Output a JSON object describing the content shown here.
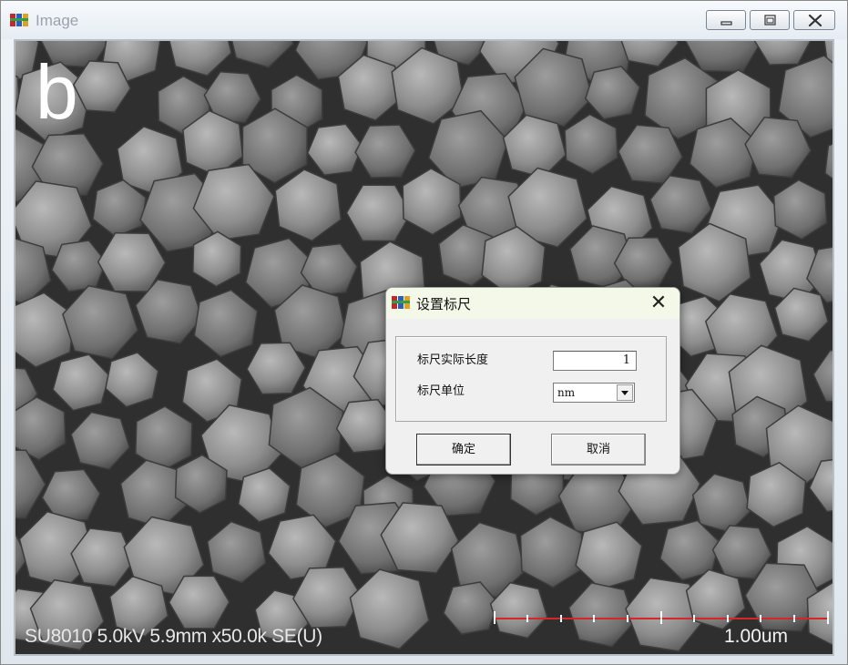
{
  "window": {
    "title": "Image",
    "controls": {
      "minimize": "minimize-icon",
      "maximize": "maximize-icon",
      "close": "close-icon"
    }
  },
  "image": {
    "panel_letter": "b",
    "sem_info": "SU8010 5.0kV 5.9mm x50.0k SE(U)",
    "scale_bar_label": "1.00um",
    "scale_bar_color": "#d62626"
  },
  "dialog": {
    "title": "设置标尺",
    "close_glyph": "✕",
    "length_label": "标尺实际长度",
    "length_value": "1",
    "unit_label": "标尺单位",
    "unit_value": "nm",
    "ok_label": "确定",
    "cancel_label": "取消"
  }
}
